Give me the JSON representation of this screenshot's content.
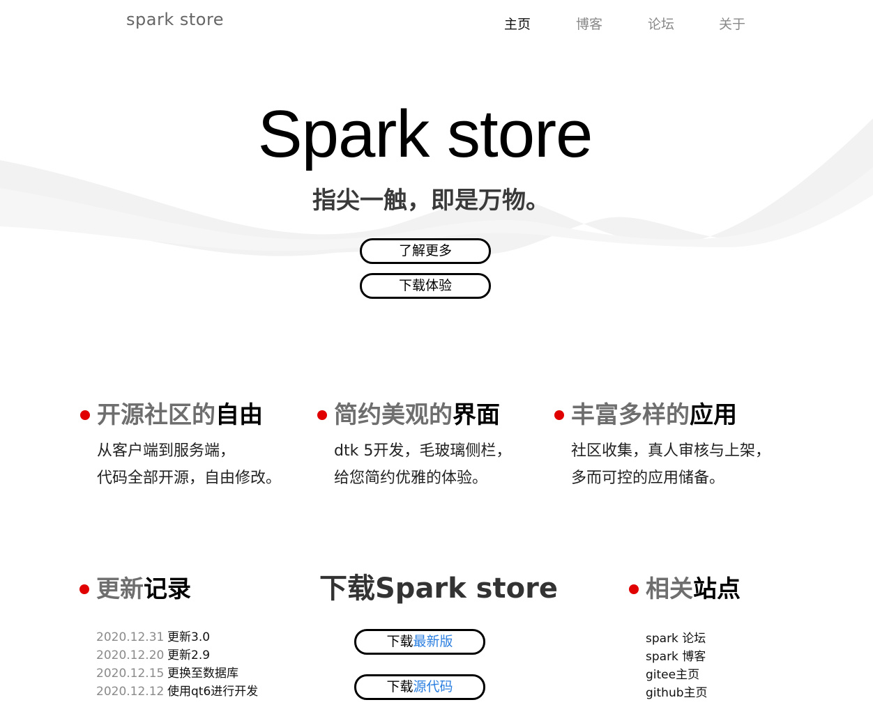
{
  "header": {
    "brand": "spark store",
    "nav": [
      "主页",
      "博客",
      "论坛",
      "关于"
    ]
  },
  "hero": {
    "title": "Spark store",
    "slogan": "指尖一触，即是万物。",
    "learn_more": "了解更多",
    "download_try": "下载体验"
  },
  "features": [
    {
      "title_grey": "开源社区的",
      "title_dark": "自由",
      "lines": [
        "从客户端到服务端，",
        "代码全部开源，自由修改。"
      ]
    },
    {
      "title_grey": "简约美观的",
      "title_dark": "界面",
      "lines": [
        "dtk 5开发，毛玻璃侧栏，",
        "给您简约优雅的体验。"
      ]
    },
    {
      "title_grey": "丰富多样的",
      "title_dark": "应用",
      "lines": [
        "社区收集，真人审核与上架，",
        "多而可控的应用储备。"
      ]
    }
  ],
  "updates": {
    "title_grey": "更新",
    "title_dark": "记录",
    "items": [
      {
        "date": "2020.12.31",
        "text": "更新3.0"
      },
      {
        "date": "2020.12.20",
        "text": "更新2.9"
      },
      {
        "date": "2020.12.15",
        "text": "更换至数据库"
      },
      {
        "date": "2020.12.12",
        "text": "使用qt6进行开发"
      }
    ]
  },
  "download": {
    "title": "下载Spark store",
    "latest_prefix": "下载",
    "latest_accent": "最新版",
    "source_prefix": "下载",
    "source_accent": "源代码"
  },
  "sites": {
    "title_grey": "相关",
    "title_dark": "站点",
    "links": [
      "spark 论坛",
      "spark 博客",
      "gitee主页",
      "github主页"
    ]
  },
  "colors": {
    "accent_dot": "#e00000",
    "link_accent": "#2b7fe0",
    "background_wave": "#f2f2f2"
  }
}
